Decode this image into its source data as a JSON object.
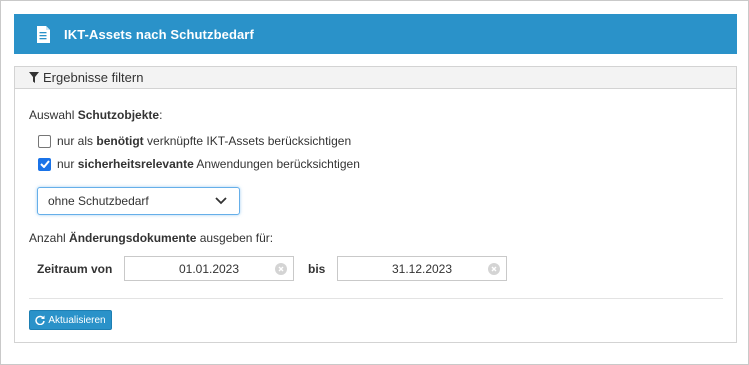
{
  "header": {
    "title": "IKT-Assets nach Schutzbedarf",
    "icon": "document-icon"
  },
  "filter": {
    "title": "Ergebnisse filtern",
    "icon": "filter-icon",
    "schutzobjekte": {
      "prefix": "Auswahl ",
      "bold": "Schutzobjekte",
      "suffix": ":"
    },
    "options": [
      {
        "checked": false,
        "prefix": "nur als ",
        "bold": "benötigt",
        "suffix": " verknüpfte IKT-Assets berücksichtigen"
      },
      {
        "checked": true,
        "prefix": "nur ",
        "bold": "sicherheitsrelevante",
        "suffix": " Anwendungen berücksichtigen"
      }
    ],
    "select": {
      "value": "ohne Schutzbedarf"
    },
    "aenderung": {
      "prefix": "Anzahl ",
      "bold": "Änderungsdokumente",
      "suffix": " ausgeben für:"
    },
    "zeitraum": {
      "label_from": "Zeitraum von",
      "from": "01.01.2023",
      "label_to": "bis",
      "to": "31.12.2023"
    },
    "refresh_label": "Aktualisieren"
  },
  "colors": {
    "accent": "#2a92c9",
    "checkbox_checked": "#1a73e8"
  }
}
